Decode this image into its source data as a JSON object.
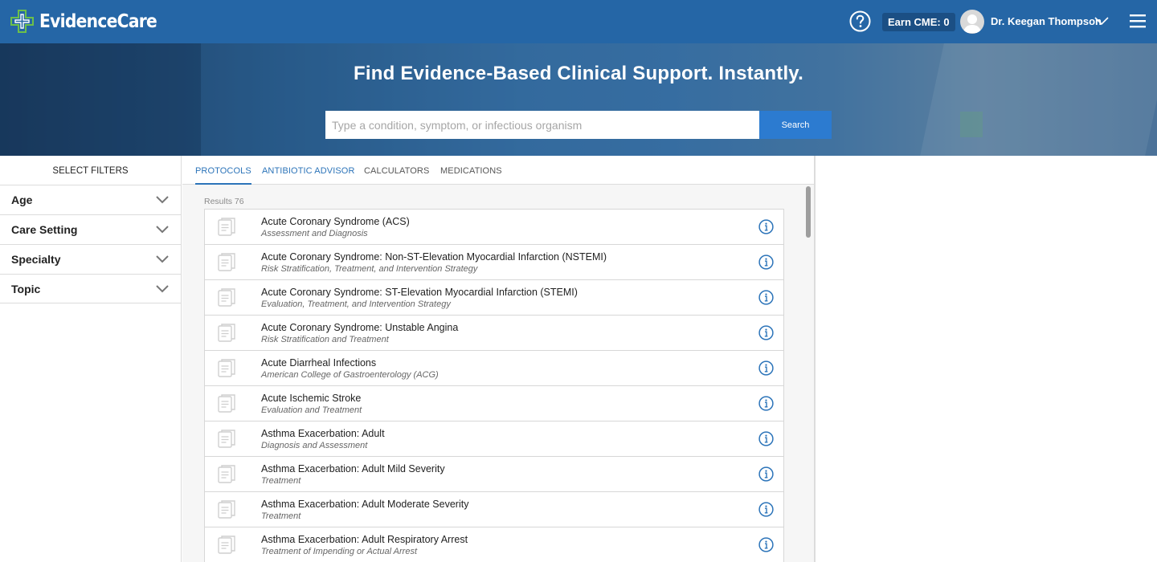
{
  "header": {
    "brand": "EvidenceCare",
    "cme_label": "Earn CME: 0",
    "user_name": "Dr. Keegan Thompson"
  },
  "hero": {
    "title": "Find Evidence-Based Clinical Support. Instantly.",
    "search_placeholder": "Type a condition, symptom, or infectious organism",
    "search_button": "Search"
  },
  "sidebar": {
    "title": "SELECT FILTERS",
    "filters": [
      {
        "label": "Age"
      },
      {
        "label": "Care Setting"
      },
      {
        "label": "Specialty"
      },
      {
        "label": "Topic"
      }
    ]
  },
  "tabs": [
    {
      "label": "PROTOCOLS",
      "active": true
    },
    {
      "label": "ANTIBIOTIC ADVISOR",
      "active": false
    },
    {
      "label": "CALCULATORS",
      "active": false
    },
    {
      "label": "MEDICATIONS",
      "active": false
    }
  ],
  "results": {
    "count_label": "Results 76",
    "items": [
      {
        "title": "Acute Coronary Syndrome (ACS)",
        "subtitle": "Assessment and Diagnosis"
      },
      {
        "title": "Acute Coronary Syndrome: Non-ST-Elevation Myocardial Infarction (NSTEMI)",
        "subtitle": "Risk Stratification, Treatment, and Intervention Strategy"
      },
      {
        "title": "Acute Coronary Syndrome: ST-Elevation Myocardial Infarction (STEMI)",
        "subtitle": "Evaluation, Treatment, and Intervention Strategy"
      },
      {
        "title": "Acute Coronary Syndrome: Unstable Angina",
        "subtitle": "Risk Stratification and Treatment"
      },
      {
        "title": "Acute Diarrheal Infections",
        "subtitle": "American College of Gastroenterology (ACG)"
      },
      {
        "title": "Acute Ischemic Stroke",
        "subtitle": "Evaluation and Treatment"
      },
      {
        "title": "Asthma Exacerbation: Adult",
        "subtitle": "Diagnosis and Assessment"
      },
      {
        "title": "Asthma Exacerbation: Adult Mild Severity",
        "subtitle": "Treatment"
      },
      {
        "title": "Asthma Exacerbation: Adult Moderate Severity",
        "subtitle": "Treatment"
      },
      {
        "title": "Asthma Exacerbation: Adult Respiratory Arrest",
        "subtitle": "Treatment of Impending or Actual Arrest"
      }
    ]
  },
  "colors": {
    "header_bg": "#2566a6",
    "accent": "#2c74b9",
    "search_button": "#2c7bd0",
    "logo_green": "#6cc04a"
  }
}
